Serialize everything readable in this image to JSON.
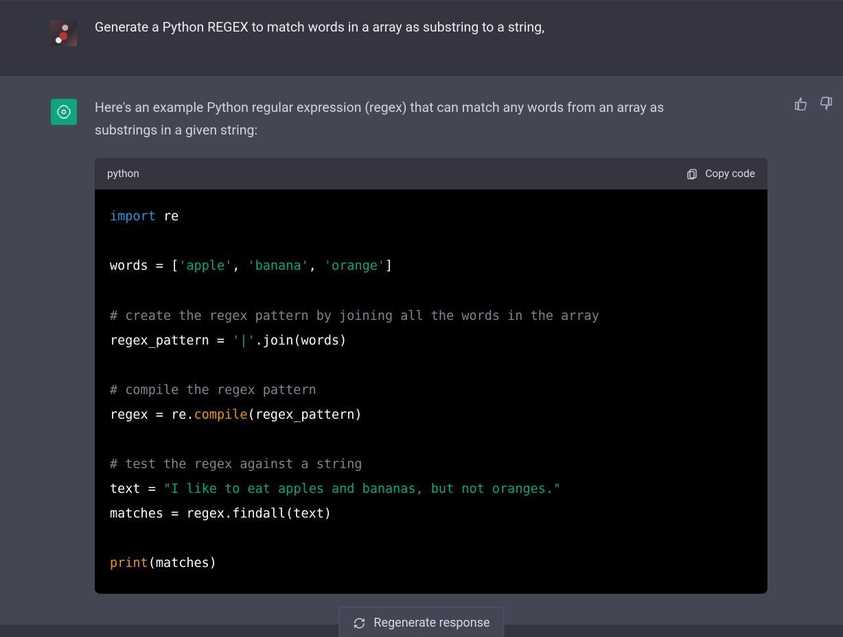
{
  "user": {
    "message": "Generate a Python REGEX to match words in a array as substring to a string,"
  },
  "assistant": {
    "intro": "Here's an example Python regular expression (regex) that can match any words from an array as substrings in a given string:",
    "code": {
      "lang_label": "python",
      "copy_label": "Copy code",
      "tokens": [
        {
          "t": "kw",
          "v": "import"
        },
        {
          "t": "w",
          "v": " re\n\n"
        },
        {
          "t": "w",
          "v": "words = ["
        },
        {
          "t": "str",
          "v": "'apple'"
        },
        {
          "t": "w",
          "v": ", "
        },
        {
          "t": "str",
          "v": "'banana'"
        },
        {
          "t": "w",
          "v": ", "
        },
        {
          "t": "str",
          "v": "'orange'"
        },
        {
          "t": "w",
          "v": "]\n\n"
        },
        {
          "t": "com",
          "v": "# create the regex pattern by joining all the words in the array"
        },
        {
          "t": "w",
          "v": "\n"
        },
        {
          "t": "w",
          "v": "regex_pattern = "
        },
        {
          "t": "str",
          "v": "'|'"
        },
        {
          "t": "w",
          "v": ".join(words)\n\n"
        },
        {
          "t": "com",
          "v": "# compile the regex pattern"
        },
        {
          "t": "w",
          "v": "\n"
        },
        {
          "t": "w",
          "v": "regex = re."
        },
        {
          "t": "fn",
          "v": "compile"
        },
        {
          "t": "w",
          "v": "(regex_pattern)\n\n"
        },
        {
          "t": "com",
          "v": "# test the regex against a string"
        },
        {
          "t": "w",
          "v": "\n"
        },
        {
          "t": "w",
          "v": "text = "
        },
        {
          "t": "str",
          "v": "\"I like to eat apples and bananas, but not oranges.\""
        },
        {
          "t": "w",
          "v": "\n"
        },
        {
          "t": "w",
          "v": "matches = regex.findall(text)\n\n"
        },
        {
          "t": "bi",
          "v": "print"
        },
        {
          "t": "w",
          "v": "(matches)"
        }
      ]
    }
  },
  "ui": {
    "regenerate_label": "Regenerate response"
  }
}
